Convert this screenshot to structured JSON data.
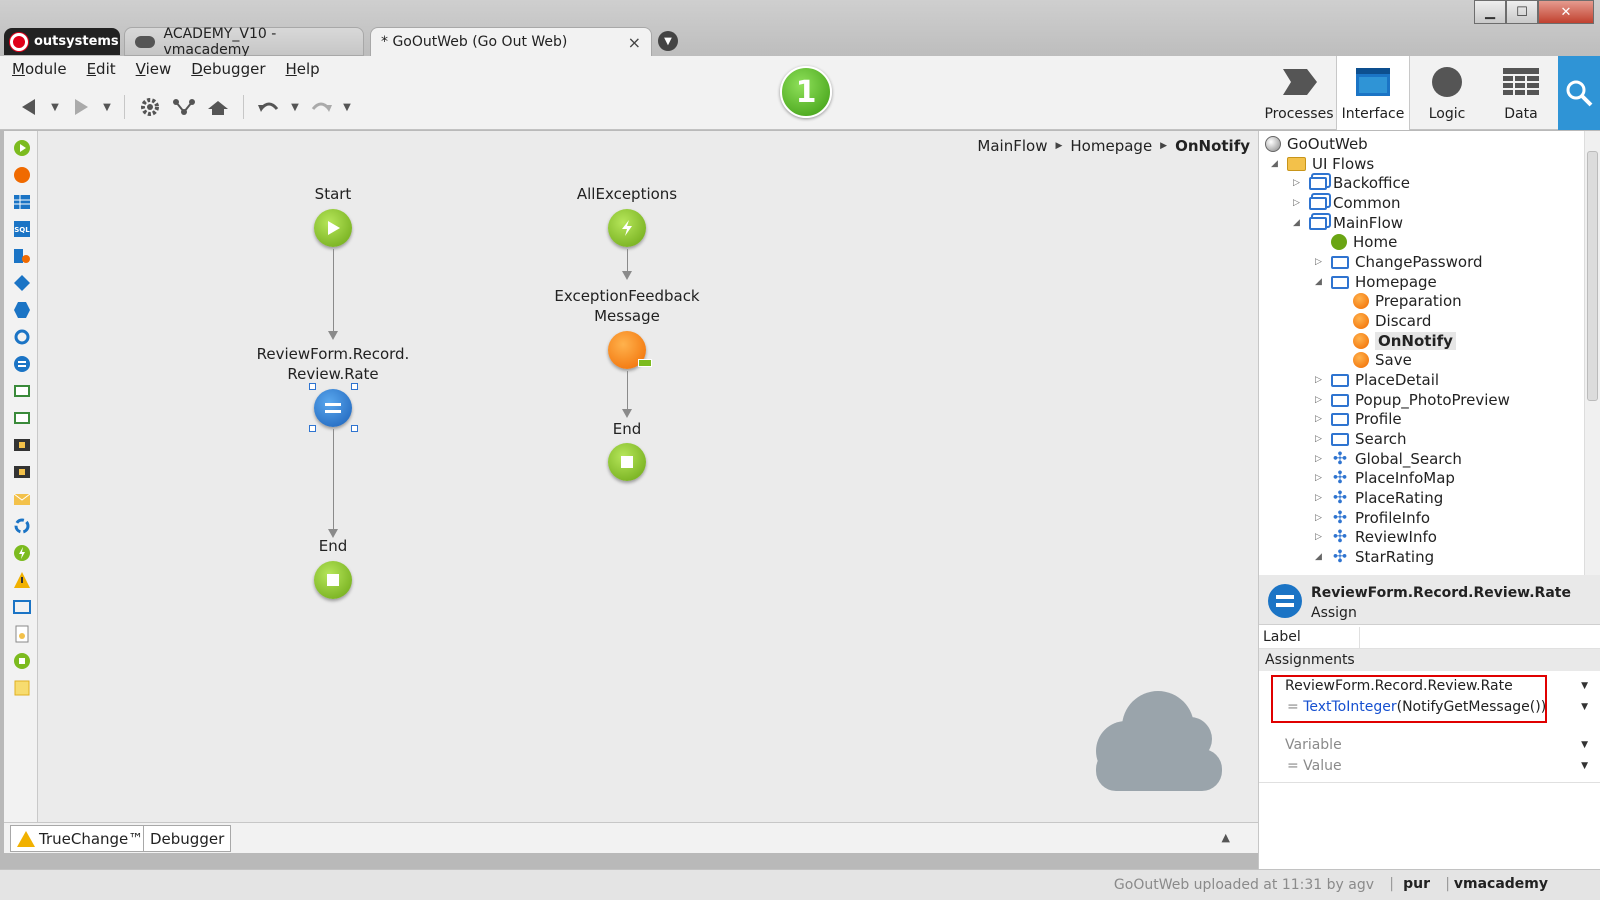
{
  "window": {
    "brand": "outsystems",
    "tabs": [
      {
        "label": "ACADEMY_V10 - vmacademy"
      },
      {
        "label": "* GoOutWeb (Go Out Web)"
      }
    ],
    "close_glyph": "×",
    "minimize_glyph": "▁",
    "maximize_glyph": "☐",
    "winclose_glyph": "✕"
  },
  "menu": [
    "Module",
    "Edit",
    "View",
    "Debugger",
    "Help"
  ],
  "toolbar": {
    "notification_count": "1",
    "back_icon": "back-arrow-icon",
    "forward_icon": "forward-arrow-icon"
  },
  "layer_tabs": [
    {
      "label": "Processes",
      "icon": "processes-icon"
    },
    {
      "label": "Interface",
      "icon": "interface-icon"
    },
    {
      "label": "Logic",
      "icon": "logic-icon"
    },
    {
      "label": "Data",
      "icon": "data-icon"
    }
  ],
  "breadcrumb": [
    "MainFlow",
    "Homepage",
    "OnNotify"
  ],
  "canvas": {
    "flow1": {
      "start": "Start",
      "assign_line1": "ReviewForm.Record.",
      "assign_line2": "Review.Rate",
      "end": "End"
    },
    "flow2": {
      "handler": "AllExceptions",
      "feedback_line1": "ExceptionFeedback",
      "feedback_line2": "Message",
      "end": "End"
    }
  },
  "bottom_tabs": [
    "TrueChange™",
    "Debugger"
  ],
  "tree": {
    "root": "GoOutWeb",
    "ui_flows": "UI Flows",
    "items": [
      {
        "label": "Backoffice"
      },
      {
        "label": "Common"
      },
      {
        "label": "MainFlow"
      },
      {
        "label": "Home"
      },
      {
        "label": "ChangePassword"
      },
      {
        "label": "Homepage"
      },
      {
        "label": "Preparation"
      },
      {
        "label": "Discard"
      },
      {
        "label": "OnNotify"
      },
      {
        "label": "Save"
      },
      {
        "label": "PlaceDetail"
      },
      {
        "label": "Popup_PhotoPreview"
      },
      {
        "label": "Profile"
      },
      {
        "label": "Search"
      },
      {
        "label": "Global_Search"
      },
      {
        "label": "PlaceInfoMap"
      },
      {
        "label": "PlaceRating"
      },
      {
        "label": "ProfileInfo"
      },
      {
        "label": "ReviewInfo"
      },
      {
        "label": "StarRating"
      }
    ]
  },
  "properties": {
    "title": "ReviewForm.Record.Review.Rate",
    "subtitle": "Assign",
    "label_field": "Label",
    "assignments_header": "Assignments",
    "assignment": {
      "variable": "ReviewForm.Record.Review.Rate",
      "eq": "=",
      "function": "TextToInteger",
      "args": "(NotifyGetMessage())"
    },
    "empty_assignment": {
      "variable": "Variable",
      "value": "= Value"
    }
  },
  "status": {
    "message": "GoOutWeb uploaded at 11:31 by agv",
    "separator": "|",
    "user": "pur",
    "server": "vmacademy"
  },
  "colors": {
    "accent_blue": "#2f94d6",
    "node_green": "#6aa514",
    "node_orange": "#f06a00",
    "highlight_red": "#e00000"
  }
}
